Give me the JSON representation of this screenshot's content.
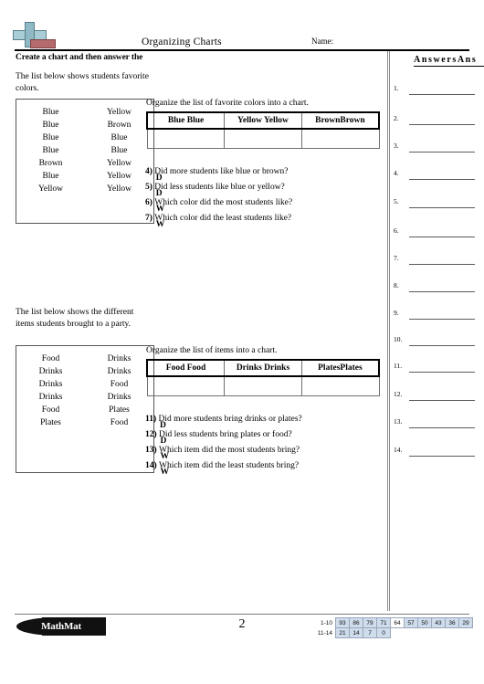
{
  "header": {
    "title": "Organizing Charts",
    "name_label": "Name:",
    "instruction": "Create a chart and then answer the",
    "logo_icon": "plus-bar-logo"
  },
  "answers": {
    "title": "AnswersAns",
    "numbers": [
      "1.",
      "2.",
      "3.",
      "4.",
      "5.",
      "6.",
      "7.",
      "8.",
      "9.",
      "10.",
      "11.",
      "12.",
      "13.",
      "14."
    ]
  },
  "section1": {
    "caption": "The list below shows students favorite colors.",
    "list": [
      [
        "Blue",
        "Yellow"
      ],
      [
        "Blue",
        "Brown"
      ],
      [
        "Blue",
        "Blue"
      ],
      [
        "Blue",
        "Blue"
      ],
      [
        "Brown",
        "Yellow"
      ],
      [
        "Blue",
        "Yellow"
      ],
      [
        "Yellow",
        "Yellow"
      ]
    ],
    "chart_prompt": "Organize the list of favorite colors into a chart.",
    "chart_headers": [
      "Blue Blue",
      "Yellow Yellow",
      "BrownBrown"
    ],
    "questions": [
      {
        "num": "4)",
        "dup": "D",
        "text": "Did more students like blue or brown?"
      },
      {
        "num": "5)",
        "dup": "D",
        "text": "Did less students like blue or yellow?"
      },
      {
        "num": "6)",
        "dup": "W",
        "text": "Which color did the most students like?"
      },
      {
        "num": "7)",
        "dup": "W",
        "text": "Which color did the least students like?"
      }
    ]
  },
  "section2": {
    "caption": "The list below shows the different items students brought to a party.",
    "list": [
      [
        "Food",
        "Drinks"
      ],
      [
        "Drinks",
        "Drinks"
      ],
      [
        "Drinks",
        "Food"
      ],
      [
        "Drinks",
        "Drinks"
      ],
      [
        "Food",
        "Plates"
      ],
      [
        "Plates",
        "Food"
      ]
    ],
    "chart_prompt": "Organize the list of items into a chart.",
    "chart_headers": [
      "Food Food",
      "Drinks Drinks",
      "PlatesPlates"
    ],
    "questions": [
      {
        "num": "11)",
        "dup": "D",
        "text": "Did more students bring drinks or plates?"
      },
      {
        "num": "12)",
        "dup": "D",
        "text": "Did less students bring plates or food?"
      },
      {
        "num": "13)",
        "dup": "W",
        "text": "Which item did the most students bring?"
      },
      {
        "num": "14)",
        "dup": "W",
        "text": "Which item did the least students bring?"
      }
    ]
  },
  "footer": {
    "brand": "MathMat",
    "page_number": "2",
    "score": {
      "row1_label": "1-10",
      "row2_label": "11-14",
      "row1_values": [
        "93",
        "86",
        "79",
        "71",
        "64",
        "57",
        "50",
        "43",
        "36",
        "29"
      ],
      "row1_shaded": [
        true,
        true,
        true,
        true,
        false,
        true,
        true,
        true,
        true,
        true
      ],
      "row2_values": [
        "21",
        "14",
        "7",
        "0"
      ],
      "row2_shaded": [
        true,
        true,
        true,
        true
      ]
    }
  }
}
